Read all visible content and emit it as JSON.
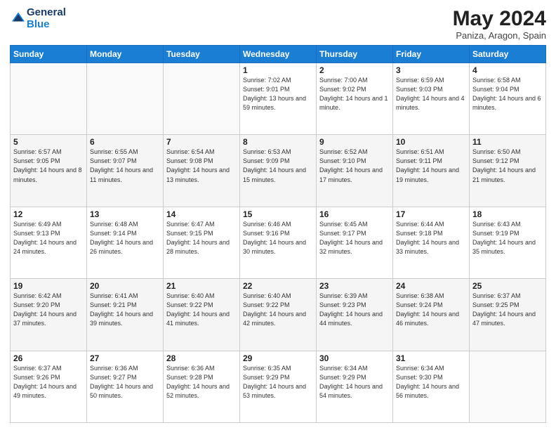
{
  "header": {
    "logo_line1": "General",
    "logo_line2": "Blue",
    "title": "May 2024",
    "subtitle": "Paniza, Aragon, Spain"
  },
  "columns": [
    "Sunday",
    "Monday",
    "Tuesday",
    "Wednesday",
    "Thursday",
    "Friday",
    "Saturday"
  ],
  "weeks": [
    [
      {
        "day": "",
        "info": ""
      },
      {
        "day": "",
        "info": ""
      },
      {
        "day": "",
        "info": ""
      },
      {
        "day": "1",
        "info": "Sunrise: 7:02 AM\nSunset: 9:01 PM\nDaylight: 13 hours and 59 minutes."
      },
      {
        "day": "2",
        "info": "Sunrise: 7:00 AM\nSunset: 9:02 PM\nDaylight: 14 hours and 1 minute."
      },
      {
        "day": "3",
        "info": "Sunrise: 6:59 AM\nSunset: 9:03 PM\nDaylight: 14 hours and 4 minutes."
      },
      {
        "day": "4",
        "info": "Sunrise: 6:58 AM\nSunset: 9:04 PM\nDaylight: 14 hours and 6 minutes."
      }
    ],
    [
      {
        "day": "5",
        "info": "Sunrise: 6:57 AM\nSunset: 9:05 PM\nDaylight: 14 hours and 8 minutes."
      },
      {
        "day": "6",
        "info": "Sunrise: 6:55 AM\nSunset: 9:07 PM\nDaylight: 14 hours and 11 minutes."
      },
      {
        "day": "7",
        "info": "Sunrise: 6:54 AM\nSunset: 9:08 PM\nDaylight: 14 hours and 13 minutes."
      },
      {
        "day": "8",
        "info": "Sunrise: 6:53 AM\nSunset: 9:09 PM\nDaylight: 14 hours and 15 minutes."
      },
      {
        "day": "9",
        "info": "Sunrise: 6:52 AM\nSunset: 9:10 PM\nDaylight: 14 hours and 17 minutes."
      },
      {
        "day": "10",
        "info": "Sunrise: 6:51 AM\nSunset: 9:11 PM\nDaylight: 14 hours and 19 minutes."
      },
      {
        "day": "11",
        "info": "Sunrise: 6:50 AM\nSunset: 9:12 PM\nDaylight: 14 hours and 21 minutes."
      }
    ],
    [
      {
        "day": "12",
        "info": "Sunrise: 6:49 AM\nSunset: 9:13 PM\nDaylight: 14 hours and 24 minutes."
      },
      {
        "day": "13",
        "info": "Sunrise: 6:48 AM\nSunset: 9:14 PM\nDaylight: 14 hours and 26 minutes."
      },
      {
        "day": "14",
        "info": "Sunrise: 6:47 AM\nSunset: 9:15 PM\nDaylight: 14 hours and 28 minutes."
      },
      {
        "day": "15",
        "info": "Sunrise: 6:46 AM\nSunset: 9:16 PM\nDaylight: 14 hours and 30 minutes."
      },
      {
        "day": "16",
        "info": "Sunrise: 6:45 AM\nSunset: 9:17 PM\nDaylight: 14 hours and 32 minutes."
      },
      {
        "day": "17",
        "info": "Sunrise: 6:44 AM\nSunset: 9:18 PM\nDaylight: 14 hours and 33 minutes."
      },
      {
        "day": "18",
        "info": "Sunrise: 6:43 AM\nSunset: 9:19 PM\nDaylight: 14 hours and 35 minutes."
      }
    ],
    [
      {
        "day": "19",
        "info": "Sunrise: 6:42 AM\nSunset: 9:20 PM\nDaylight: 14 hours and 37 minutes."
      },
      {
        "day": "20",
        "info": "Sunrise: 6:41 AM\nSunset: 9:21 PM\nDaylight: 14 hours and 39 minutes."
      },
      {
        "day": "21",
        "info": "Sunrise: 6:40 AM\nSunset: 9:22 PM\nDaylight: 14 hours and 41 minutes."
      },
      {
        "day": "22",
        "info": "Sunrise: 6:40 AM\nSunset: 9:22 PM\nDaylight: 14 hours and 42 minutes."
      },
      {
        "day": "23",
        "info": "Sunrise: 6:39 AM\nSunset: 9:23 PM\nDaylight: 14 hours and 44 minutes."
      },
      {
        "day": "24",
        "info": "Sunrise: 6:38 AM\nSunset: 9:24 PM\nDaylight: 14 hours and 46 minutes."
      },
      {
        "day": "25",
        "info": "Sunrise: 6:37 AM\nSunset: 9:25 PM\nDaylight: 14 hours and 47 minutes."
      }
    ],
    [
      {
        "day": "26",
        "info": "Sunrise: 6:37 AM\nSunset: 9:26 PM\nDaylight: 14 hours and 49 minutes."
      },
      {
        "day": "27",
        "info": "Sunrise: 6:36 AM\nSunset: 9:27 PM\nDaylight: 14 hours and 50 minutes."
      },
      {
        "day": "28",
        "info": "Sunrise: 6:36 AM\nSunset: 9:28 PM\nDaylight: 14 hours and 52 minutes."
      },
      {
        "day": "29",
        "info": "Sunrise: 6:35 AM\nSunset: 9:29 PM\nDaylight: 14 hours and 53 minutes."
      },
      {
        "day": "30",
        "info": "Sunrise: 6:34 AM\nSunset: 9:29 PM\nDaylight: 14 hours and 54 minutes."
      },
      {
        "day": "31",
        "info": "Sunrise: 6:34 AM\nSunset: 9:30 PM\nDaylight: 14 hours and 56 minutes."
      },
      {
        "day": "",
        "info": ""
      }
    ]
  ]
}
